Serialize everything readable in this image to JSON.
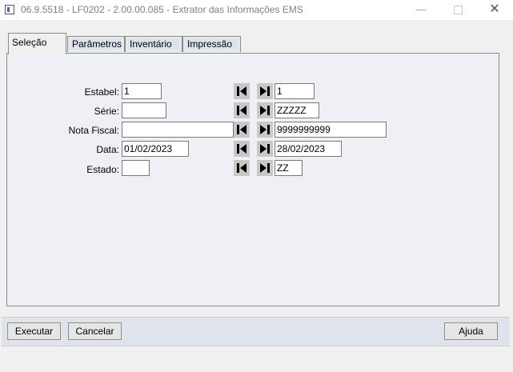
{
  "window": {
    "title": "06.9.5518 - LF0202 - 2.00.00.085 - Extrator das Informações EMS",
    "minimize_glyph": "—",
    "close_glyph": "✕"
  },
  "tabs": [
    {
      "label": "Seleção",
      "selected": true
    },
    {
      "label": "Parâmetros",
      "selected": false
    },
    {
      "label": "Inventário",
      "selected": false
    },
    {
      "label": "Impressão",
      "selected": false
    }
  ],
  "selection": {
    "rows": [
      {
        "label": "Estabel:",
        "from": "1",
        "to": "1"
      },
      {
        "label": "Série:",
        "from": "",
        "to": "ZZZZZ"
      },
      {
        "label": "Nota Fiscal:",
        "from": "",
        "to": "9999999999"
      },
      {
        "label": "Data:",
        "from": "01/02/2023",
        "to": "28/02/2023"
      },
      {
        "label": "Estado:",
        "from": "",
        "to": "ZZ"
      }
    ]
  },
  "buttons": {
    "execute": "Executar",
    "cancel": "Cancelar",
    "help": "Ajuda"
  },
  "icons": {
    "first": "skip-first-icon",
    "last": "skip-last-icon"
  }
}
